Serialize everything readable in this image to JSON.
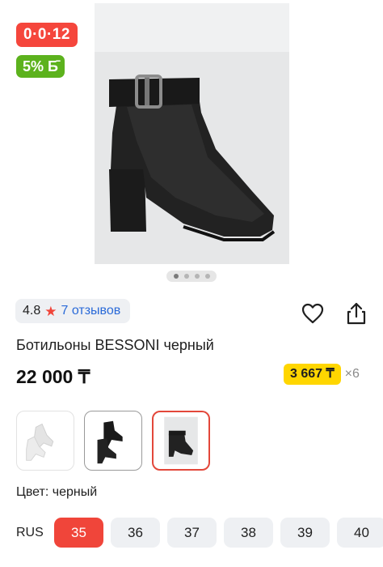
{
  "badges": {
    "timer": "0·0·12",
    "cashback": "5% Б̄"
  },
  "gallery": {
    "slides": 4,
    "active_slide": 1
  },
  "rating": {
    "value": "4.8",
    "reviews": "7 отзывов"
  },
  "product": {
    "title": "Ботильоны BESSONI черный",
    "price": "22 000 ₸"
  },
  "installment": {
    "amount": "3 667 ₸",
    "multiplier": "×6"
  },
  "color": {
    "label": "Цвет: черный"
  },
  "sizes": {
    "system": "RUS",
    "options": [
      "35",
      "36",
      "37",
      "38",
      "39",
      "40"
    ],
    "selected": "35"
  },
  "colors": {
    "accent": "#f0453a",
    "cashback": "#5cb21d",
    "installment": "#ffd600",
    "link": "#2a6ad8"
  }
}
